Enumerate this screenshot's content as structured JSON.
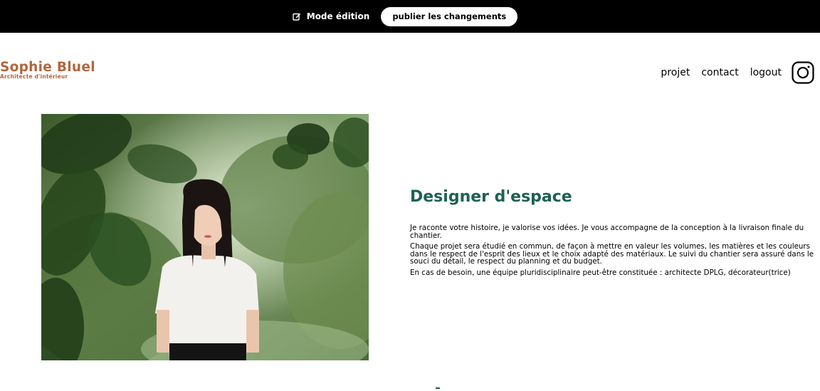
{
  "edit_bar": {
    "mode_label": "Mode édition",
    "publish_label": "publier les changements"
  },
  "brand": {
    "name": "Sophie Bluel",
    "subtitle": "Architecte d'intérieur",
    "color": "#B1663C"
  },
  "nav": {
    "items": [
      "projet",
      "contact",
      "logout"
    ],
    "social_icon": "instagram-icon"
  },
  "intro": {
    "title": "Designer d'espace",
    "title_color": "#1D6154",
    "paragraphs": [
      "Je raconte votre histoire, je valorise vos idées. Je vous accompagne de la conception à la livraison finale du chantier.",
      "Chaque projet sera étudié en commun, de façon à mettre en valeur les volumes, les matières et les couleurs dans le respect de l'esprit des lieux et le choix adapté des matériaux. Le suivi du chantier sera assuré dans le souci du détail, le respect du planning et du budget.",
      "En cas de besoin, une équipe pluridisciplinaire peut-être constituée : architecte DPLG, décorateur(trice)"
    ]
  }
}
